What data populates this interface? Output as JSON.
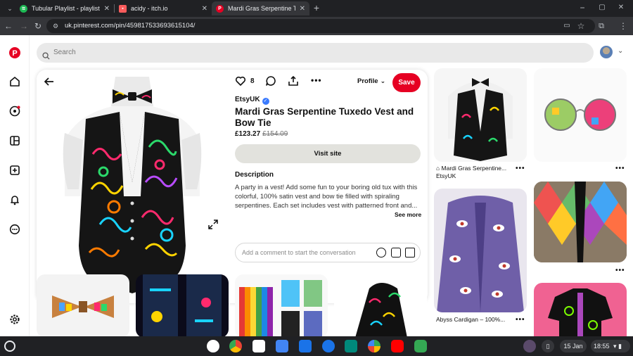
{
  "browser": {
    "tabs": [
      {
        "title": "Tubular Playlist - playlist by aci",
        "color": "#1db954"
      },
      {
        "title": "acidy - itch.io",
        "color": "#fa5c5c"
      },
      {
        "title": "Mardi Gras Serpentine Tuxedo",
        "color": "#e60023"
      }
    ],
    "new_tab": "+",
    "url": "uk.pinterest.com/pin/459817533693615104/"
  },
  "search": {
    "placeholder": "Search"
  },
  "pin": {
    "likes": "8",
    "profile_label": "Profile",
    "save_label": "Save",
    "shop": "EtsyUK",
    "title": "Mardi Gras Serpentine Tuxedo Vest and Bow Tie",
    "price": "£123.27",
    "old_price": "£154.09",
    "visit_label": "Visit site",
    "description_heading": "Description",
    "description": "A party in a vest! Add some fun to your boring old tux with this colorful, 100% satin vest and bow tie filled with spiraling serpentines. Each set includes vest with patterned front and...",
    "see_more": "See more",
    "comment_placeholder": "Add a comment to start the conversation"
  },
  "feed": {
    "items": [
      {
        "caption": "Mardi Gras Serpentine...",
        "sub": "EtsyUK"
      },
      {
        "caption": "Abyss Cardigan – 100%..."
      }
    ]
  },
  "shelf": {
    "date": "15 Jan",
    "time": "18:55"
  },
  "colors": {
    "accent": "#e60023",
    "verified": "#3a7afe"
  }
}
